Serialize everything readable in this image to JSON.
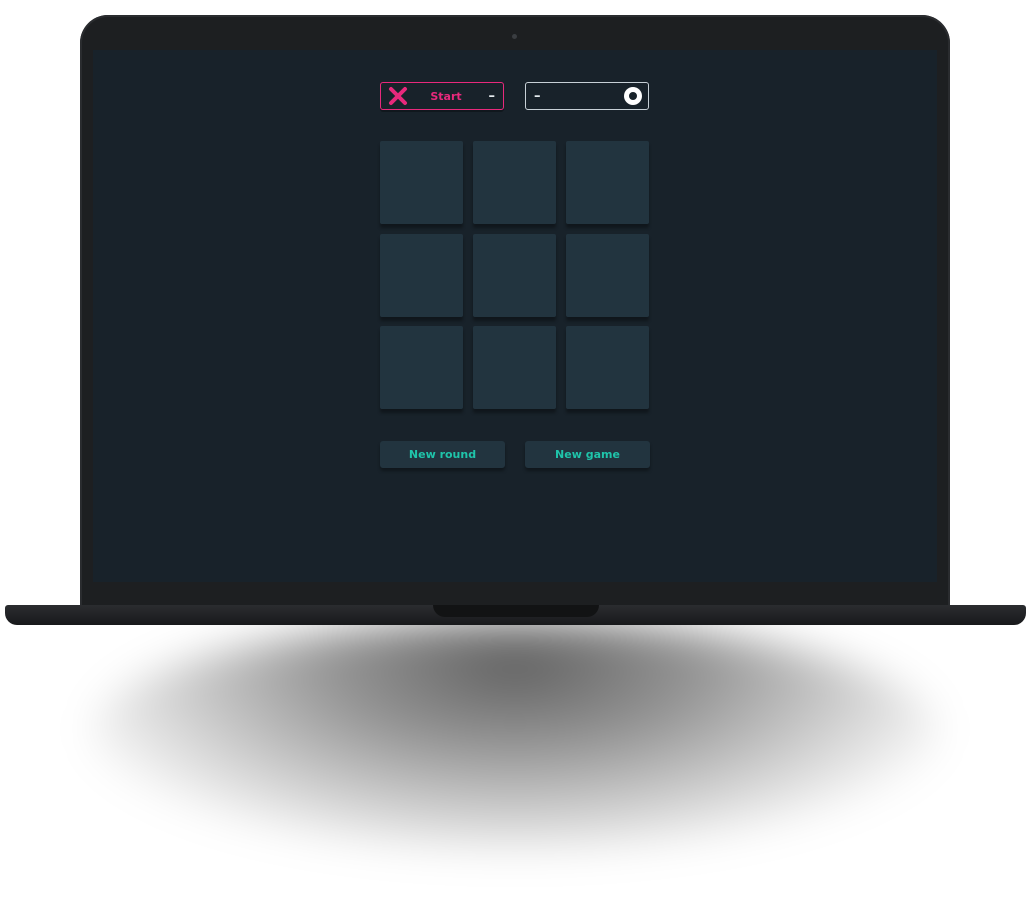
{
  "turn": {
    "player_x_status": "Start",
    "player_x_score": "–",
    "player_o_score": "–"
  },
  "board": {
    "cells": [
      "",
      "",
      "",
      "",
      "",
      "",
      "",
      "",
      ""
    ]
  },
  "actions": {
    "new_round_label": "New round",
    "new_game_label": "New game"
  },
  "colors": {
    "accent_x": "#e8297c",
    "accent_button_text": "#1fc4aa",
    "screen_background": "#18222a",
    "cell_background": "#22343f"
  },
  "icons": {
    "player_x": "x-icon",
    "player_o": "o-icon"
  }
}
